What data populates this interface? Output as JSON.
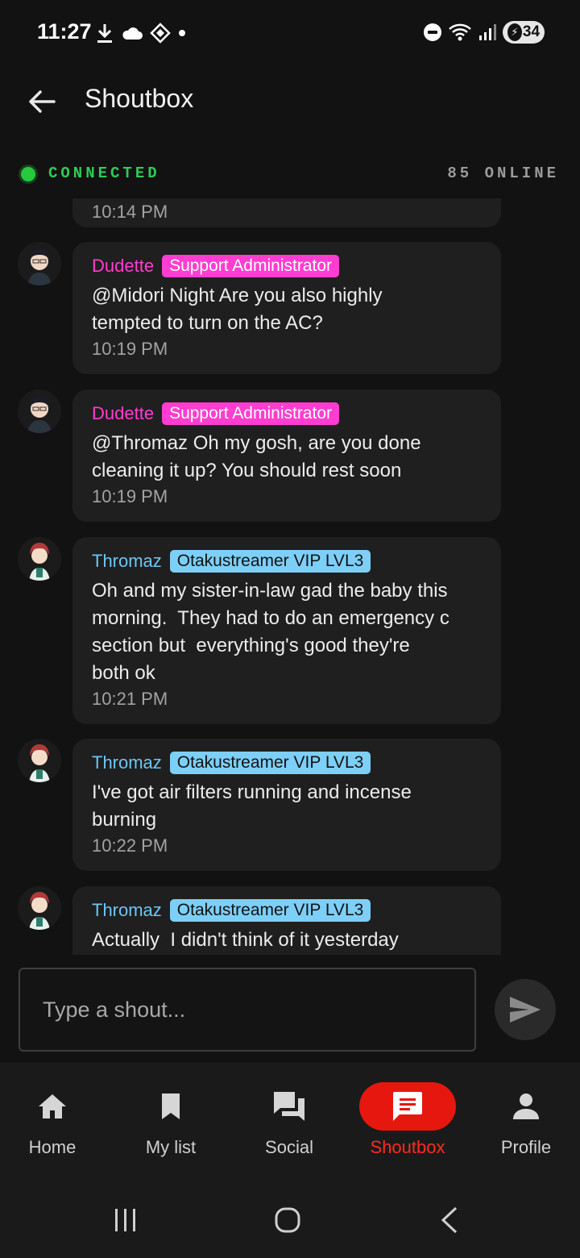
{
  "status_bar": {
    "time": "11:27",
    "battery": "34",
    "icons": [
      "download-icon",
      "cloud-icon",
      "vpn-icon",
      "dot-icon",
      "dnd-icon",
      "wifi-icon",
      "signal-icon",
      "battery-icon"
    ]
  },
  "app_bar": {
    "title": "Shoutbox"
  },
  "connection": {
    "status": "CONNECTED",
    "online": "85 ONLINE",
    "status_color": "#2ecc55"
  },
  "messages": {
    "partial_time": "10:14 PM",
    "items": [
      {
        "user": "Dudette",
        "badge": "Support Administrator",
        "text": "@Midori Night Are you also highly\ntempted to turn on the AC?",
        "time": "10:19 PM"
      },
      {
        "user": "Dudette",
        "badge": "Support Administrator",
        "text": "@Thromaz Oh my gosh, are you done\ncleaning it up? You should rest soon",
        "time": "10:19 PM"
      },
      {
        "user": "Thromaz",
        "badge": "Otakustreamer VIP LVL3",
        "text": "Oh and my sister-in-law gad the baby this\nmorning.  They had to do an emergency c\nsection but  everything's good they're\nboth ok",
        "time": "10:21 PM"
      },
      {
        "user": "Thromaz",
        "badge": "Otakustreamer VIP LVL3",
        "text": "I've got air filters running and incense\nburning",
        "time": "10:22 PM"
      },
      {
        "user": "Thromaz",
        "badge": "Otakustreamer VIP LVL3",
        "text": "Actually  I didn't think of it yesterday",
        "time": ""
      }
    ]
  },
  "composer": {
    "placeholder": "Type a shout..."
  },
  "bottom_nav": {
    "items": [
      {
        "label": "Home",
        "icon": "home-icon"
      },
      {
        "label": "My list",
        "icon": "bookmark-icon"
      },
      {
        "label": "Social",
        "icon": "forum-icon"
      },
      {
        "label": "Shoutbox",
        "icon": "chat-icon",
        "active": true
      },
      {
        "label": "Profile",
        "icon": "person-icon"
      }
    ],
    "active_color": "#e6170e"
  }
}
